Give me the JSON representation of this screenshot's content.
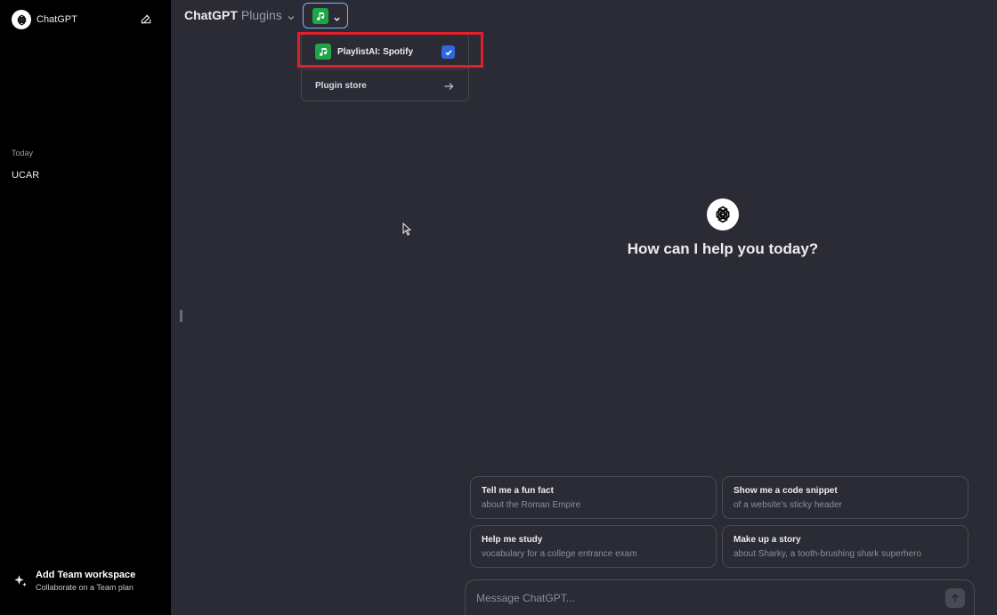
{
  "sidebar": {
    "app_name": "ChatGPT",
    "section_label": "Today",
    "history": [
      {
        "label": "UCAR"
      }
    ],
    "footer": {
      "title": "Add Team workspace",
      "subtitle": "Collaborate on a Team plan"
    }
  },
  "header": {
    "model_name": "ChatGPT",
    "model_variant": "Plugins"
  },
  "plugin_dropdown": {
    "selected_plugin": {
      "label": "PlaylistAI: Spotify",
      "checked": true,
      "icon": "music-note-icon"
    },
    "store_label": "Plugin store"
  },
  "main": {
    "greeting": "How can I help you today?"
  },
  "suggestions": [
    {
      "title": "Tell me a fun fact",
      "subtitle": "about the Roman Empire"
    },
    {
      "title": "Show me a code snippet",
      "subtitle": "of a website's sticky header"
    },
    {
      "title": "Help me study",
      "subtitle": "vocabulary for a college entrance exam"
    },
    {
      "title": "Make up a story",
      "subtitle": "about Sharky, a tooth-brushing shark superhero"
    }
  ],
  "composer": {
    "placeholder": "Message ChatGPT..."
  },
  "colors": {
    "sidebar_bg": "#000000",
    "main_bg": "#2b2b35",
    "plugin_green": "#1ea548",
    "check_blue": "#2f67e0",
    "highlight_red": "#e2202a"
  }
}
